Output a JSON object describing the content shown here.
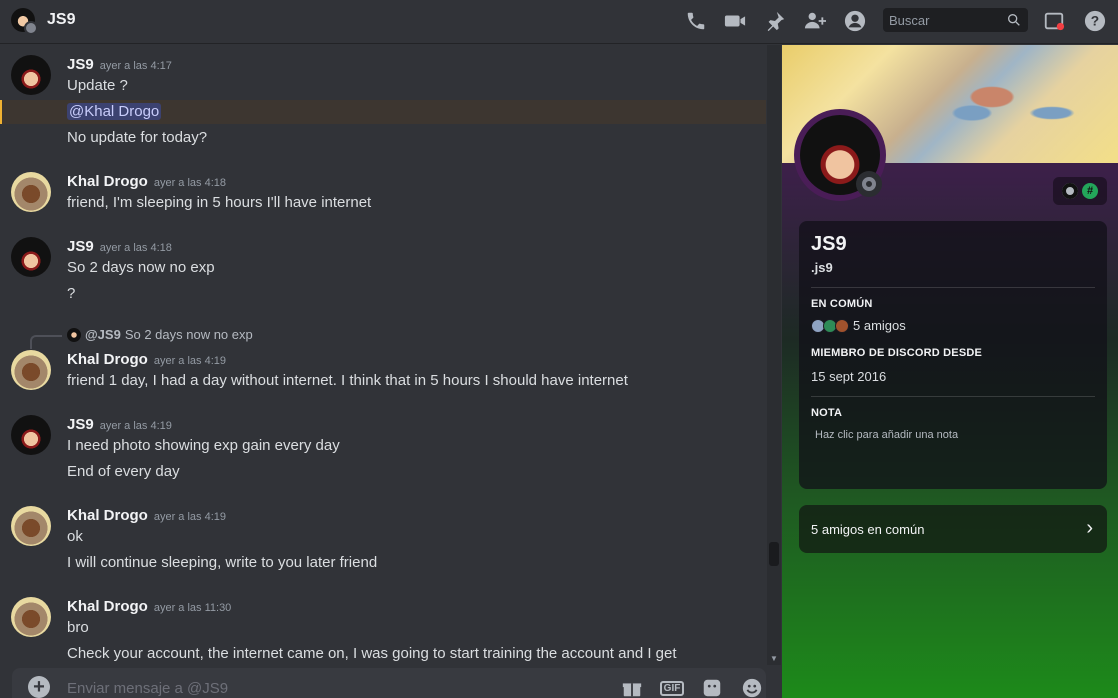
{
  "header": {
    "title": "JS9",
    "search_placeholder": "Buscar"
  },
  "messages": [
    {
      "author": "JS9",
      "timestamp": "ayer a las 4:17",
      "lines": [
        "Update ?",
        "@Khal Drogo",
        "No update for today?"
      ]
    },
    {
      "author": "Khal Drogo",
      "timestamp": "ayer a las 4:18",
      "lines": [
        "friend, I'm sleeping in 5 hours I'll have internet"
      ]
    },
    {
      "author": "JS9",
      "timestamp": "ayer a las 4:18",
      "lines": [
        "So 2 days now no exp",
        "?"
      ]
    },
    {
      "reply_to": "@JS9",
      "reply_text": "So 2 days now no exp",
      "author": "Khal Drogo",
      "timestamp": "ayer a las 4:19",
      "lines": [
        "friend 1 day, I had a day without internet. I think that in 5 hours I should have internet"
      ]
    },
    {
      "author": "JS9",
      "timestamp": "ayer a las 4:19",
      "lines": [
        "I need photo showing exp gain every day",
        "End of every day"
      ]
    },
    {
      "author": "Khal Drogo",
      "timestamp": "ayer a las 4:19",
      "lines": [
        "ok",
        "I will continue sleeping, write to you later friend"
      ]
    },
    {
      "author": "Khal Drogo",
      "timestamp": "ayer a las 11:30",
      "lines": [
        "bro",
        "Check your account, the internet came on, I was going to start training the account and I get"
      ]
    }
  ],
  "composer": {
    "placeholder": "Enviar mensaje a @JS9",
    "gif_label": "GIF"
  },
  "profile": {
    "display_name": "JS9",
    "username": ".js9",
    "in_common_heading": "EN COMÚN",
    "in_common_text": "5 amigos",
    "member_since_heading": "MIEMBRO DE DISCORD DESDE",
    "member_since": "15 sept 2016",
    "note_heading": "NOTA",
    "note_placeholder": "Haz clic para añadir una nota",
    "mutual_friends_row": "5 amigos en común",
    "badge_hash": "#"
  },
  "colors": {
    "background": "#313338",
    "mention_bg": "#3c4270",
    "highlight_border": "#f0b232",
    "online_status": "#80848e"
  }
}
